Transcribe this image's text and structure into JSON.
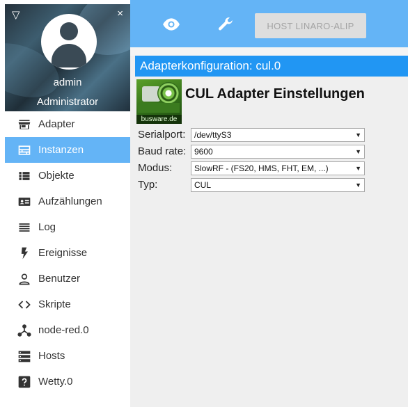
{
  "sidebar": {
    "menu_toggle_glyph": "▽",
    "close_glyph": "×",
    "user": {
      "name": "admin",
      "role": "Administrator"
    },
    "items": [
      {
        "label": "Adapter",
        "icon": "store-icon",
        "active": false
      },
      {
        "label": "Instanzen",
        "icon": "subtitles-icon",
        "active": true
      },
      {
        "label": "Objekte",
        "icon": "list-icon",
        "active": false
      },
      {
        "label": "Aufzählungen",
        "icon": "contact-card-icon",
        "active": false
      },
      {
        "label": "Log",
        "icon": "lines-icon",
        "active": false
      },
      {
        "label": "Ereignisse",
        "icon": "lightning-icon",
        "active": false
      },
      {
        "label": "Benutzer",
        "icon": "person-icon",
        "active": false
      },
      {
        "label": "Skripte",
        "icon": "code-icon",
        "active": false
      },
      {
        "label": "node-red.0",
        "icon": "network-icon",
        "active": false
      },
      {
        "label": "Hosts",
        "icon": "server-icon",
        "active": false
      },
      {
        "label": "Wetty.0",
        "icon": "help-box-icon",
        "active": false
      }
    ]
  },
  "topbar": {
    "host_button": "HOST LINARO-ALIP",
    "icons": [
      "eye-icon",
      "wrench-icon"
    ]
  },
  "config": {
    "header": "Adapterkonfiguration: cul.0",
    "title": "CUL Adapter Einstellungen",
    "logo_text": "busware.de",
    "fields": [
      {
        "label": "Serialport:",
        "value": "/dev/ttyS3"
      },
      {
        "label": "Baud rate:",
        "value": "9600"
      },
      {
        "label": "Modus:",
        "value": "SlowRF - (FS20, HMS, FHT, EM, ...)"
      },
      {
        "label": "Typ:",
        "value": "CUL"
      }
    ]
  },
  "colors": {
    "accent": "#64b4f6",
    "header_blue": "#2196f3",
    "panel_bg": "#efefef"
  }
}
